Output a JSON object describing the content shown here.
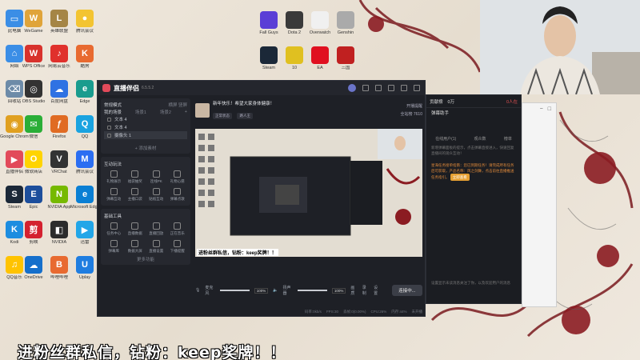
{
  "desktop": {
    "icons": [
      {
        "label": "此电脑",
        "color": "#3b8ee6",
        "glyph": "▭"
      },
      {
        "label": "WeGame",
        "color": "#e0a43a",
        "glyph": "W"
      },
      {
        "label": "英雄联盟",
        "color": "#a58545",
        "glyph": "L"
      },
      {
        "label": "腾讯会议",
        "color": "#f3c431",
        "glyph": "●"
      },
      {
        "label": "网络",
        "color": "#3b8ee6",
        "glyph": "⌂"
      },
      {
        "label": "WPS Office",
        "color": "#d8322c",
        "glyph": "W"
      },
      {
        "label": "网易云音乐",
        "color": "#e0312c",
        "glyph": "♪"
      },
      {
        "label": "酷狗",
        "color": "#e86a30",
        "glyph": "K"
      },
      {
        "label": "回收站",
        "color": "#6d8ba8",
        "glyph": "⌫"
      },
      {
        "label": "OBS Studio",
        "color": "#333",
        "glyph": "◎"
      },
      {
        "label": "百度网盘",
        "color": "#2f72e3",
        "glyph": "☁"
      },
      {
        "label": "Edge",
        "color": "#1a9c8e",
        "glyph": "e"
      },
      {
        "label": "Google Chrome",
        "color": "#e0a020",
        "glyph": "◉"
      },
      {
        "label": "微信",
        "color": "#2aae37",
        "glyph": "✉"
      },
      {
        "label": "Firefox",
        "color": "#e06b23",
        "glyph": "ƒ"
      },
      {
        "label": "QQ",
        "color": "#1aa3e0",
        "glyph": "Q"
      },
      {
        "label": "直播伴侣",
        "color": "#e24a5a",
        "glyph": "▶"
      },
      {
        "label": "微软商店",
        "color": "#ffd400",
        "glyph": "O"
      },
      {
        "label": "VRChat",
        "color": "#333",
        "glyph": "V"
      },
      {
        "label": "腾讯会议",
        "color": "#2b6ef2",
        "glyph": "M"
      },
      {
        "label": "Steam",
        "color": "#1b2838",
        "glyph": "S"
      },
      {
        "label": "Epic",
        "color": "#1c4e9c",
        "glyph": "E"
      },
      {
        "label": "NVIDIA App",
        "color": "#76b900",
        "glyph": "N"
      },
      {
        "label": "Microsoft Edge",
        "color": "#0a7fd4",
        "glyph": "e"
      },
      {
        "label": "Kodi",
        "color": "#1d8de0",
        "glyph": "K"
      },
      {
        "label": "剪映",
        "color": "#d4212f",
        "glyph": "剪"
      },
      {
        "label": "NVIDIA",
        "color": "#2c2c2c",
        "glyph": "◧"
      },
      {
        "label": "迅雷",
        "color": "#22a6e8",
        "glyph": "▶"
      },
      {
        "label": "QQ音乐",
        "color": "#ffc300",
        "glyph": "♫"
      },
      {
        "label": "OneDrive",
        "color": "#156fcb",
        "glyph": "☁"
      },
      {
        "label": "哔哩哔哩",
        "color": "#e86a30",
        "glyph": "B"
      },
      {
        "label": "Uplay",
        "color": "#1f7de0",
        "glyph": "U"
      }
    ],
    "top_icons": [
      {
        "label": "Fall Guys",
        "color": "#5a3ed6"
      },
      {
        "label": "Dota 2",
        "color": "#3a3a3a"
      },
      {
        "label": "Overwatch",
        "color": "#f0f0f0"
      },
      {
        "label": "Genshin",
        "color": "#aaa"
      },
      {
        "label": "Steam",
        "color": "#1b2838"
      },
      {
        "label": "10",
        "color": "#e0c020"
      },
      {
        "label": "EA",
        "color": "#e01020"
      },
      {
        "label": "三国",
        "color": "#c02020"
      }
    ]
  },
  "app": {
    "name": "直播伴侣",
    "version": "6.5.5.2",
    "scene_panel": {
      "mode_label": "常规模式",
      "mode_actions": [
        "横屏",
        "竖屏"
      ],
      "scene_label": "我的场景",
      "scene_items": [
        "场景1",
        "场景2"
      ],
      "sources": [
        "文本 4",
        "文本 4",
        "摄像头 1"
      ],
      "add_source": "+ 添加素材"
    },
    "interaction_panel": {
      "title": "互动玩法",
      "tools": [
        {
          "label": "礼物展示"
        },
        {
          "label": "福袋抽奖"
        },
        {
          "label": "连线PK"
        },
        {
          "label": "礼物心愿"
        },
        {
          "label": "弹幕互动"
        },
        {
          "label": "主播口袋"
        },
        {
          "label": "贴纸互动"
        },
        {
          "label": "弹幕点歌"
        }
      ]
    },
    "basic_tools": {
      "title": "基础工具",
      "tools": [
        {
          "label": "任务中心"
        },
        {
          "label": "直播数据"
        },
        {
          "label": "直播回放"
        },
        {
          "label": "正在音乐"
        },
        {
          "label": "弹幕库"
        },
        {
          "label": "数据大屏"
        },
        {
          "label": "直播设置"
        },
        {
          "label": "下播提醒"
        }
      ],
      "more": "更多功能"
    },
    "notice": {
      "text": "新年快乐！希望大家身体健康！",
      "tags": [
        "正常状态",
        "路人王"
      ],
      "right_actions": [
        "开播提醒",
        "全站榜",
        "7610"
      ]
    },
    "caption": "进粉丝群私信，钻粉：keep奖牌！！",
    "controls": {
      "mic_label": "麦克风",
      "mic_volume": "100%",
      "speaker_label": "扬声器",
      "speaker_volume": "100%",
      "mic_level": 1.0,
      "speaker_level": 1.0,
      "action_labels": [
        "画质",
        "录制",
        "设置"
      ],
      "connect_button": "连接中..."
    },
    "status": [
      "码率:0kb/s",
      "FPS:30",
      "丢帧:0(0.00%)",
      "CPU:26%",
      "内存:44%",
      "未开播"
    ]
  },
  "side_panel": {
    "tabs_top": [
      "贡献榜",
      "0万"
    ],
    "tab_active": "0人在",
    "title": "弹幕助手",
    "tabs": [
      "在线用户(1)",
      "观众数",
      "榜单"
    ],
    "help_text": "新增弹幕面板的提示，点击弹幕直接进入，快速回复直播间的观众互动！",
    "orange_line": "星海任务接单指南：您已到期任务！请完成所有任务后可获取，产品名称：风之剑舞，点击前往直播推送任务指引。",
    "help_button": "立即查看",
    "bottom_text": "设置显示未读消息关注了你，以及欢迎用户的消息"
  },
  "subtitle": "进粉丝群私信，钻粉：keep奖牌！！"
}
